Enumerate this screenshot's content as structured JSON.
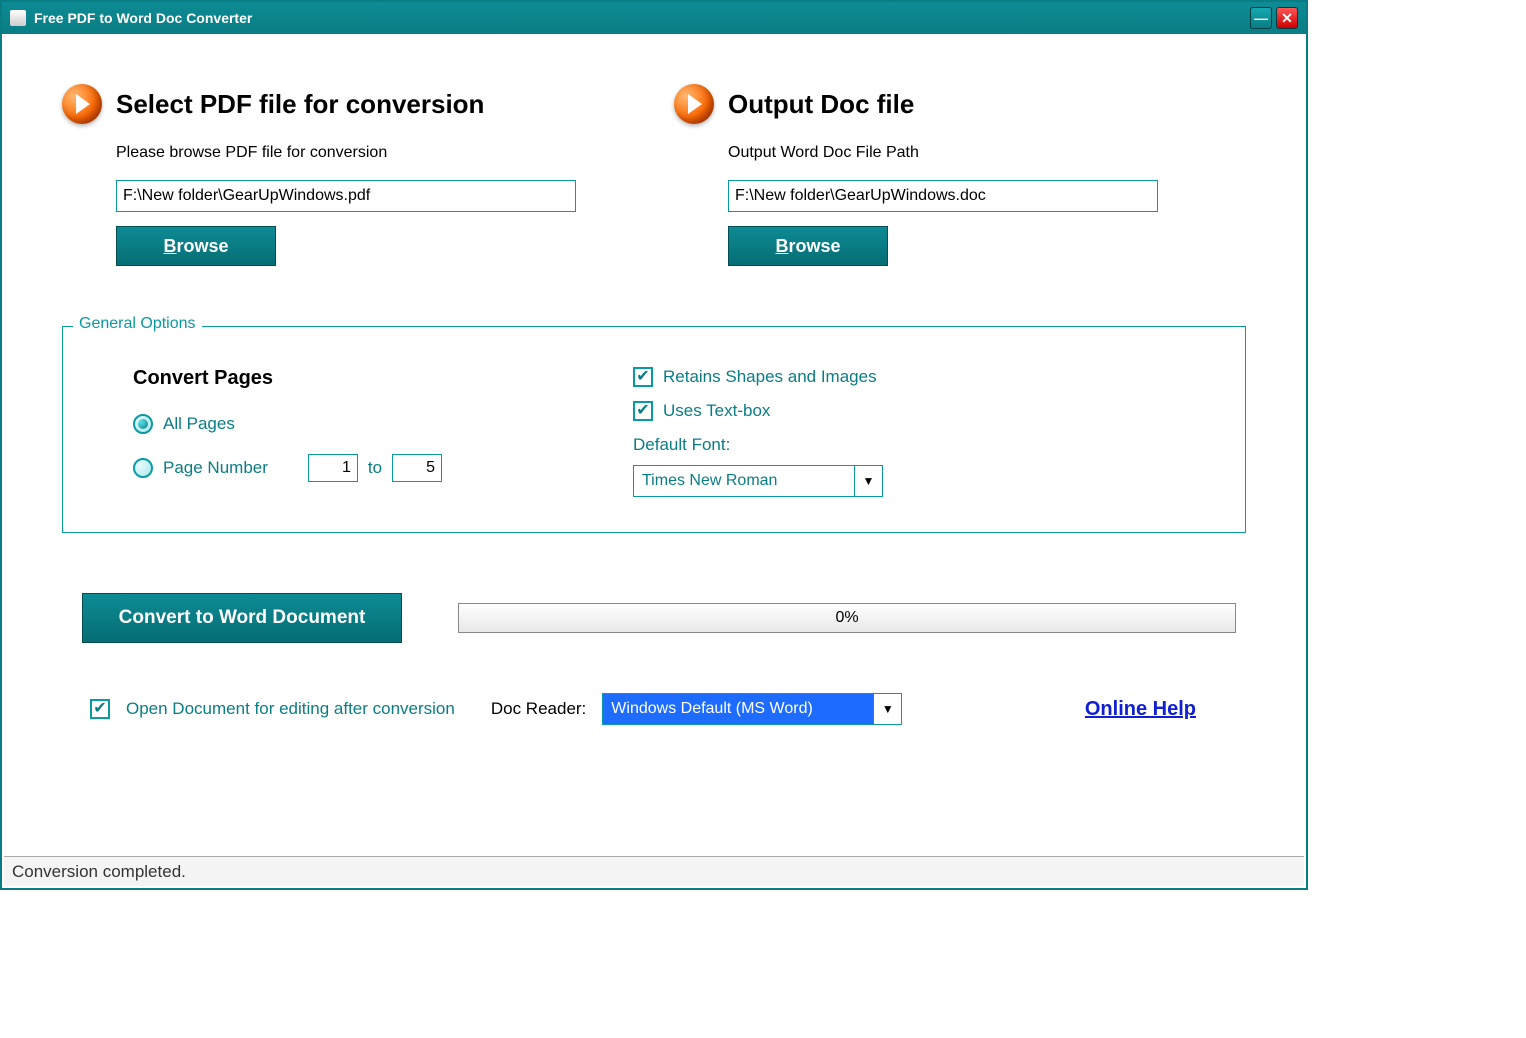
{
  "title": "Free PDF to Word Doc Converter",
  "input": {
    "heading": "Select PDF file for conversion",
    "label": "Please browse PDF file for conversion",
    "path": "F:\\New folder\\GearUpWindows.pdf",
    "browse": "Browse"
  },
  "output": {
    "heading": "Output Doc file",
    "label": "Output Word Doc File Path",
    "path": "F:\\New folder\\GearUpWindows.doc",
    "browse": "Browse"
  },
  "options": {
    "legend": "General Options",
    "convert_pages_label": "Convert Pages",
    "all_pages": "All Pages",
    "page_number": "Page Number",
    "from": "1",
    "to_label": "to",
    "to": "5",
    "retains": "Retains Shapes and Images",
    "textbox": "Uses Text-box",
    "default_font_label": "Default Font:",
    "default_font": "Times New Roman"
  },
  "convert_button": "Convert to Word Document",
  "progress": "0%",
  "open_after": "Open Document for editing after conversion",
  "doc_reader_label": "Doc Reader:",
  "doc_reader": "Windows Default (MS Word)",
  "online_help": "Online Help",
  "status": "Conversion completed."
}
